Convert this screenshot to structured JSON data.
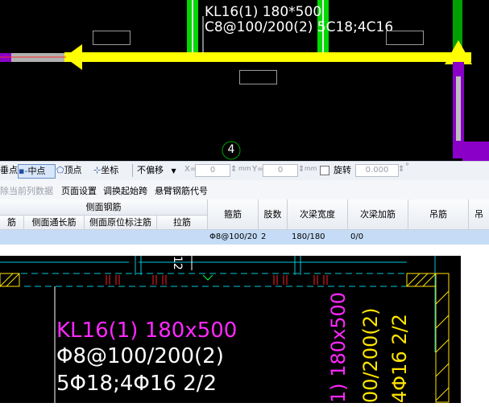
{
  "cad_top": {
    "beam_line1": "KL16(1) 180*500",
    "beam_line2": "C8@100/200(2) 5C18;4C16",
    "axis_label": "4"
  },
  "toolbar": {
    "items": [
      {
        "label": "垂点"
      },
      {
        "label": "中点"
      },
      {
        "label": "顶点"
      },
      {
        "label": "坐标"
      },
      {
        "label": "不偏移"
      },
      {
        "label": "X="
      },
      {
        "label": "0"
      },
      {
        "label": "mm"
      },
      {
        "label": "Y="
      },
      {
        "label": "0"
      },
      {
        "label": "mm"
      },
      {
        "label": "旋转"
      },
      {
        "label": "0.000"
      },
      {
        "label": "°"
      }
    ]
  },
  "menu": {
    "items": [
      {
        "label": "除当前列数据"
      },
      {
        "label": "页面设置"
      },
      {
        "label": "调换起始跨"
      },
      {
        "label": "悬臂钢筋代号"
      }
    ]
  },
  "table": {
    "group_header": "侧面钢筋",
    "headers": [
      "筋",
      "侧面通长筋",
      "侧面原位标注筋",
      "拉筋",
      "箍筋",
      "肢数",
      "次梁宽度",
      "次梁加筋",
      "吊筋",
      "吊"
    ],
    "row": [
      "Φ8@100/20",
      "2",
      "180/180",
      "0/0"
    ]
  },
  "cad_bottom": {
    "dim_text": "12",
    "beam_line1": "KL16(1) 180x500",
    "beam_line2": "Φ8@100/200(2)",
    "beam_line3": "5Φ18;4Φ16 2/2",
    "vert_magenta": "1) 180x500",
    "vert_yellow1": "00/200(2)",
    "vert_yellow2": "4Φ16 2/2"
  },
  "colors": {
    "beam_yellow": "#ffff00",
    "column_green": "#00e000",
    "purple": "#8a00c8",
    "magenta_text": "#ff28ff",
    "cyan_line": "#00c8d8",
    "red_mark": "#ff2020",
    "selected_row": "#c6dcf6"
  }
}
